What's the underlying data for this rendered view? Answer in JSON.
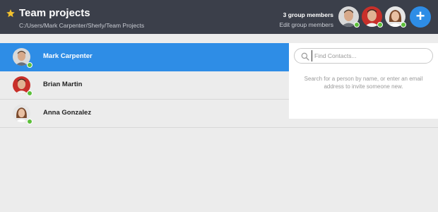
{
  "header": {
    "title": "Team projects",
    "path": "C:/Users/Mark Carpenter/Sherly/Team Projects",
    "members_count": "3 group members",
    "edit_members": "Edit group members",
    "add_label": "+",
    "avatars": [
      {
        "icon": "avatar-man-dark-hair",
        "online": true
      },
      {
        "icon": "avatar-man-red-background",
        "online": true
      },
      {
        "icon": "avatar-woman-brown-hair",
        "online": true
      }
    ]
  },
  "members": [
    {
      "name": "Mark Carpenter",
      "selected": true,
      "online": true
    },
    {
      "name": "Brian Martin",
      "selected": false,
      "online": true
    },
    {
      "name": "Anna Gonzalez",
      "selected": false,
      "online": true
    }
  ],
  "search": {
    "placeholder": "Find Contacts...",
    "hint": "Search for a person by name, or enter an email address to invite someone new."
  },
  "colors": {
    "header_bg": "#3b3f4a",
    "accent": "#2e8de6",
    "online": "#5cbf3a",
    "star": "#f2c12e"
  }
}
